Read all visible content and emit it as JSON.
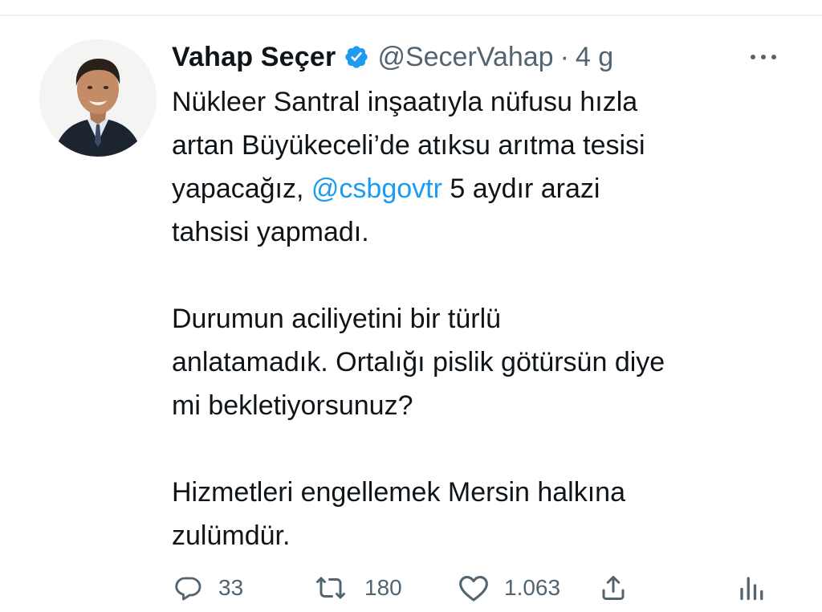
{
  "tweet": {
    "author": {
      "display_name": "Vahap Seçer",
      "handle": "@SecerVahap",
      "verified": true
    },
    "separator": "·",
    "timestamp": "4 g",
    "body": {
      "paragraph1": {
        "line1": "Nükleer Santral inşaatıyla nüfusu hızla",
        "line2": "artan Büyükeceli’de atıksu arıtma tesisi",
        "line3_before": "yapacağız, ",
        "line3_mention": "@csbgovtr",
        "line3_after": " 5 aydır arazi",
        "line4": "tahsisi yapmadı."
      },
      "paragraph2": {
        "line1": "Durumun aciliyetini bir türlü",
        "line2": "anlatamadık. Ortalığı pislik götürsün diye",
        "line3": "mi bekletiyorsunuz?"
      },
      "paragraph3": {
        "line1": "Hizmetleri engellemek Mersin halkına",
        "line2": "zulümdür."
      }
    },
    "actions": {
      "reply": {
        "icon": "reply-icon",
        "count": "33"
      },
      "retweet": {
        "icon": "retweet-icon",
        "count": "180"
      },
      "like": {
        "icon": "heart-icon",
        "count": "1.063"
      },
      "share": {
        "icon": "share-icon"
      },
      "analytics": {
        "icon": "analytics-icon"
      }
    }
  },
  "colors": {
    "text_primary": "#0f1419",
    "text_secondary": "#536471",
    "link": "#1d9bf0",
    "verified_badge": "#1d9bf0",
    "divider": "#eff3f4"
  }
}
